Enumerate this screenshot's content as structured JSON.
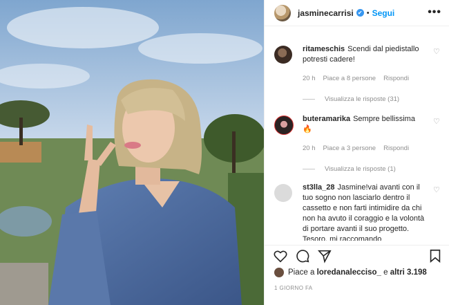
{
  "header": {
    "username": "jasminecarrisi",
    "verified_mark": "✔",
    "separator": "•",
    "follow_label": "Segui",
    "more_label": "•••"
  },
  "comments": [
    {
      "username": "ritameschis",
      "text": "Scendi dal piedistallo potresti cadere!",
      "time": "20 h",
      "likes": "Piace a 8 persone",
      "reply_label": "Rispondi",
      "view_replies": "Visualizza le risposte (31)"
    },
    {
      "username": "buteramarika",
      "text": "Sempre bellissima 🔥",
      "time": "20 h",
      "likes": "Piace a 3 persone",
      "reply_label": "Rispondi",
      "view_replies": "Visualizza le risposte (1)"
    },
    {
      "username": "st3lla_28",
      "text": "Jasmine!vai avanti con il tuo sogno non lasciarlo dentro il cassetto e non farti intimidire da chi non ha avuto il coraggio e la volontà di portare avanti il suo progetto. Tesoro, mi raccomando"
    }
  ],
  "likes_line": {
    "prefix": "Piace a ",
    "user": "loredanalecciso_",
    "suffix": " e ",
    "others": "altri 3.198"
  },
  "timestamp": "1 GIORNO FA",
  "icons": [
    "verified-icon",
    "more-icon",
    "heart-icon",
    "comment-icon",
    "share-icon",
    "save-icon"
  ]
}
